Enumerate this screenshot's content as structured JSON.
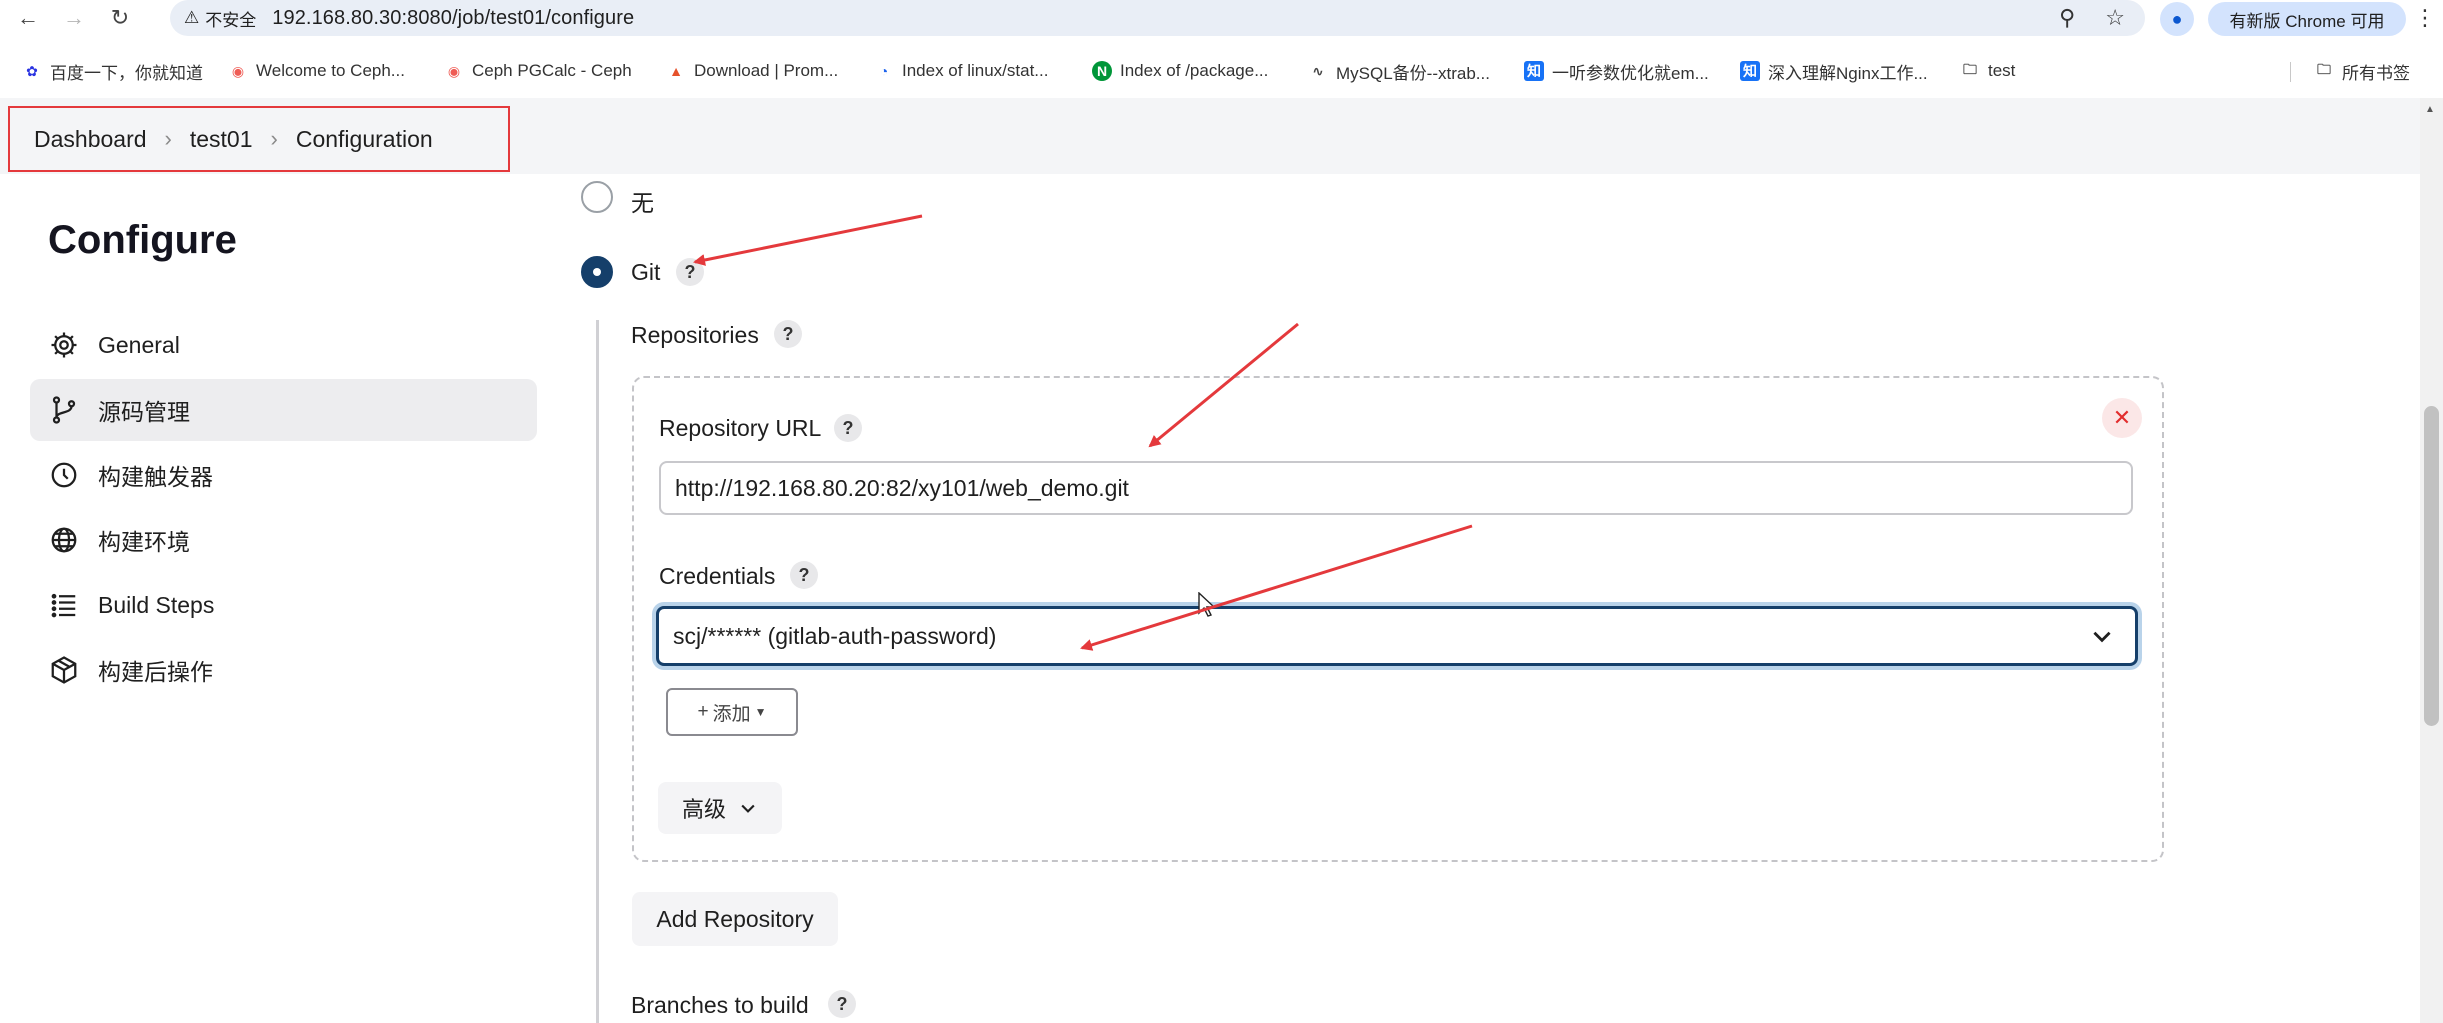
{
  "browser": {
    "insecure_label": "不安全",
    "url": "192.168.80.30:8080/job/test01/configure",
    "update_label": "有新版 Chrome 可用",
    "bookmarks": [
      {
        "label": "百度一下，你就知道",
        "icon": "paw-icon",
        "color": "#2932e1"
      },
      {
        "label": "Welcome to Ceph...",
        "icon": "ceph-icon",
        "color": "#ef5c55"
      },
      {
        "label": "Ceph PGCalc - Ceph",
        "icon": "ceph-icon",
        "color": "#ef5c55"
      },
      {
        "label": "Download | Prom...",
        "icon": "prometheus-icon",
        "color": "#e6522c"
      },
      {
        "label": "Index of linux/stat...",
        "icon": "docker-icon",
        "color": "#1d63ed"
      },
      {
        "label": "Index of /package...",
        "icon": "nginx-icon",
        "color": "#009639"
      },
      {
        "label": "MySQL备份--xtrab...",
        "icon": "mysql-icon",
        "color": "#444444"
      },
      {
        "label": "一听参数优化就em...",
        "icon": "zhihu-icon",
        "color": "#1772f6"
      },
      {
        "label": "深入理解Nginx工作...",
        "icon": "zhihu-icon",
        "color": "#1772f6"
      },
      {
        "label": "test",
        "icon": "folder-icon",
        "color": "#444444"
      }
    ],
    "all_bookmarks": "所有书签"
  },
  "breadcrumb": {
    "dashboard": "Dashboard",
    "job": "test01",
    "page": "Configuration"
  },
  "sidebar": {
    "title": "Configure",
    "items": [
      {
        "label": "General",
        "icon": "gear-icon"
      },
      {
        "label": "源码管理",
        "icon": "branch-icon"
      },
      {
        "label": "构建触发器",
        "icon": "clock-icon"
      },
      {
        "label": "构建环境",
        "icon": "globe-icon"
      },
      {
        "label": "Build Steps",
        "icon": "list-icon"
      },
      {
        "label": "构建后操作",
        "icon": "package-icon"
      }
    ]
  },
  "scm": {
    "option_none": "无",
    "option_git": "Git",
    "repositories_label": "Repositories",
    "repo_url_label": "Repository URL",
    "repo_url_value": "http://192.168.80.20:82/xy101/web_demo.git",
    "credentials_label": "Credentials",
    "credentials_value": "scj/****** (gitlab-auth-password)",
    "add_label": "添加",
    "advanced_label": "高级",
    "add_repository_label": "Add Repository",
    "branches_label": "Branches to build"
  },
  "colors": {
    "accent": "#153f6a",
    "annotation_red": "#e4393c",
    "close_red": "#e22d2d"
  }
}
